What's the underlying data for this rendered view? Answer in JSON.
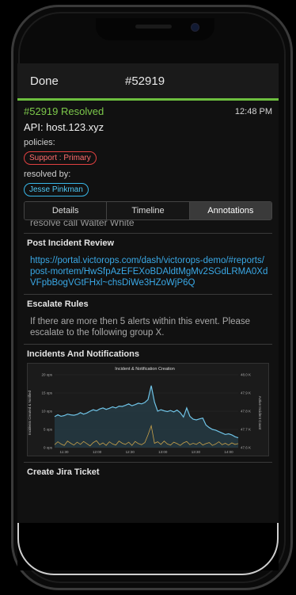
{
  "navbar": {
    "done_label": "Done",
    "title": "#52919"
  },
  "incident": {
    "status": "#52919 Resolved",
    "time": "12:48 PM",
    "api": "API: host.123.xyz",
    "policies_label": "policies:",
    "policy": "Support : Primary",
    "resolved_label": "resolved by:",
    "resolver": "Jesse Pinkman"
  },
  "tabs": [
    "Details",
    "Timeline",
    "Annotations"
  ],
  "content": {
    "cut_text": "resolve call Walter White",
    "pir_title": "Post Incident Review",
    "pir_link": "https://portal.victorops.com/dash/victorops-demo/#reports/post-mortem/HwSfpAzEFEXoBDAldtMgMv2SGdLRMA0XdVFpbBogVGtFHxl~chsDiWe3HZoWjP6Q",
    "escalate_title": "Escalate Rules",
    "escalate_text": "If there are more then 5 alerts within this event. Please escalate to the following group X.",
    "incidents_title": "Incidents And Notifications",
    "jira_title": "Create Jira Ticket"
  },
  "colors": {
    "accent_green": "#6dbf3f",
    "link_blue": "#39a8e6",
    "policy_red": "#e04040",
    "resolver_blue": "#38b7e8"
  },
  "chart_data": {
    "type": "line",
    "title": "Incident & Notification Creation",
    "ylabel": "Incidents Created & Notified",
    "y2label": "Active Incident Count",
    "x": [
      "11:30",
      "12:00",
      "12:30",
      "13:00",
      "13:30",
      "14:00"
    ],
    "y_ticks": [
      "20 ops",
      "15 ops",
      "10 ops",
      "5 ops",
      "0 ops"
    ],
    "y2_ticks": [
      "48.0 K",
      "47.9 K",
      "47.8 K",
      "47.7 K",
      "47.6 K"
    ],
    "ylim": [
      0,
      20
    ],
    "y2lim": [
      47.6,
      48.0
    ],
    "series": [
      {
        "color": "#6fc3e6",
        "values": [
          8.5,
          9.0,
          8.6,
          8.8,
          9.2,
          9.0,
          8.9,
          9.1,
          9.6,
          9.2,
          9.5,
          10.0,
          10.4,
          10.1,
          10.6,
          10.9,
          10.5,
          10.8,
          11.2,
          10.9,
          11.4,
          11.3,
          11.6,
          12.0,
          11.5,
          11.8,
          12.2,
          12.0,
          12.4,
          13.2,
          17.0,
          12.5,
          10.0,
          10.4,
          10.1,
          9.9,
          10.2,
          9.8,
          10.3,
          9.6,
          8.4,
          10.9,
          8.6,
          7.8,
          7.6,
          7.9,
          8.1,
          6.2,
          5.5,
          5.0,
          4.8,
          4.4,
          4.0,
          3.6,
          3.8,
          3.5,
          3.0,
          2.7
        ]
      },
      {
        "color": "#c9a14a",
        "values": [
          0.8,
          1.6,
          1.0,
          0.6,
          1.8,
          1.2,
          0.7,
          1.5,
          0.9,
          1.7,
          1.1,
          0.5,
          1.4,
          1.9,
          0.8,
          1.3,
          0.6,
          1.6,
          1.0,
          0.7,
          1.8,
          1.2,
          0.9,
          1.5,
          0.6,
          1.7,
          1.1,
          0.8,
          1.4,
          3.5,
          6.0,
          1.2,
          1.6,
          0.9,
          1.8,
          1.0,
          0.7,
          1.5,
          1.1,
          0.6,
          1.3,
          1.7,
          0.8,
          1.2,
          0.9,
          1.5,
          0.7,
          1.1,
          1.4,
          0.6,
          1.0,
          1.6,
          0.8,
          1.2,
          0.7,
          1.3,
          0.9,
          1.1
        ]
      }
    ]
  }
}
